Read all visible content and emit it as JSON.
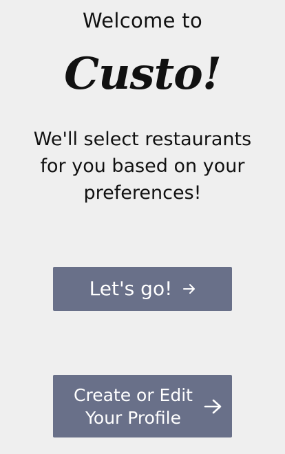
{
  "header": {
    "welcome_text": "Welcome to",
    "brand_name": "Custo!"
  },
  "intro": {
    "tagline_line1": "We'll select restaurants",
    "tagline_line2": "for you based on your",
    "tagline_line3": "preferences!"
  },
  "actions": {
    "lets_go_label": "Let's go!",
    "profile_label_line1": "Create or Edit",
    "profile_label_line2": "Your Profile",
    "arrow_icon": "arrow-right-icon"
  },
  "colors": {
    "background": "#efefef",
    "button": "#697089",
    "button_text": "#ffffff",
    "text": "#111111"
  }
}
